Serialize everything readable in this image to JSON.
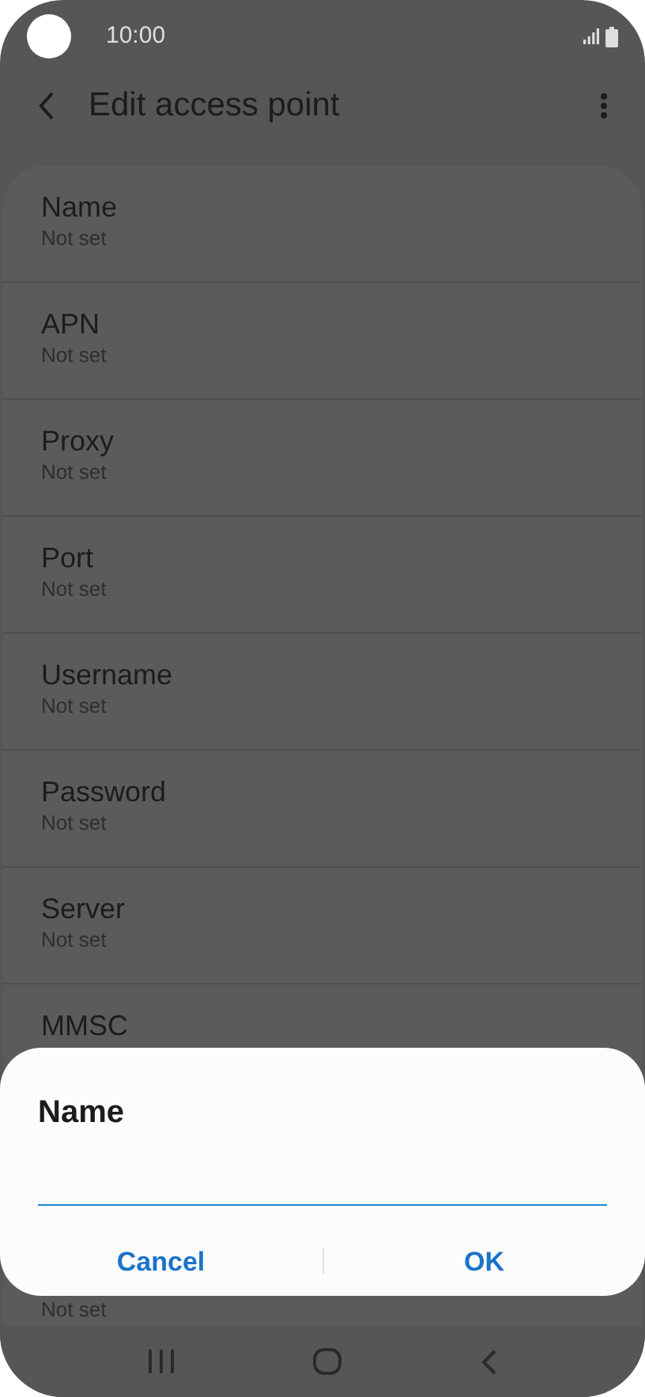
{
  "status_bar": {
    "time": "10:00"
  },
  "header": {
    "title": "Edit access point"
  },
  "settings": [
    {
      "title": "Name",
      "subtitle": "Not set"
    },
    {
      "title": "APN",
      "subtitle": "Not set"
    },
    {
      "title": "Proxy",
      "subtitle": "Not set"
    },
    {
      "title": "Port",
      "subtitle": "Not set"
    },
    {
      "title": "Username",
      "subtitle": "Not set"
    },
    {
      "title": "Password",
      "subtitle": "Not set"
    },
    {
      "title": "Server",
      "subtitle": "Not set"
    },
    {
      "title": "MMSC"
    },
    {
      "subtitle": "Not set"
    }
  ],
  "dialog": {
    "title": "Name",
    "buttons": [
      "Cancel",
      "OK"
    ]
  }
}
